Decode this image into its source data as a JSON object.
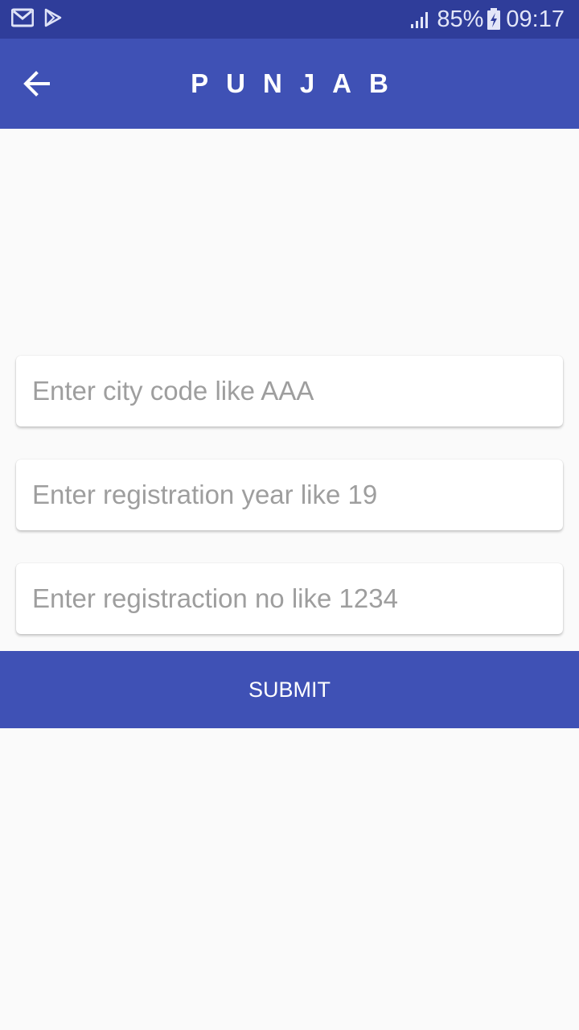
{
  "status_bar": {
    "battery": "85%",
    "time": "09:17",
    "icons": [
      "gmail-icon",
      "play-store-icon",
      "signal-icon",
      "battery-charging-icon"
    ]
  },
  "toolbar": {
    "title": "PUNJAB",
    "back_icon": "arrow-back-icon"
  },
  "form": {
    "city_code_placeholder": "Enter city code like AAA",
    "city_code_value": "",
    "year_placeholder": "Enter registration year like 19",
    "year_value": "",
    "reg_no_placeholder": "Enter registraction no like 1234",
    "reg_no_value": "",
    "submit_label": "SUBMIT"
  },
  "colors": {
    "primary": "#3f51b5",
    "primary_dark": "#2f3d9a",
    "background": "#fafafa",
    "placeholder": "#9e9e9e"
  }
}
